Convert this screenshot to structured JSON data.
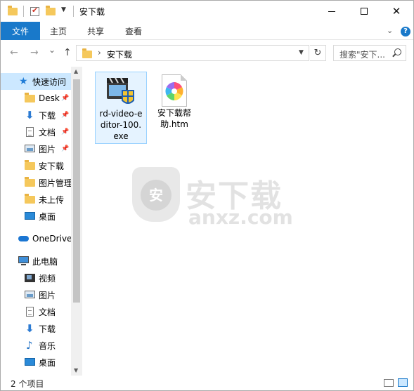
{
  "window": {
    "title": "安下载",
    "controls": {
      "minimize": "minimize",
      "maximize": "maximize",
      "close": "✕"
    }
  },
  "ribbon": {
    "tabs": [
      {
        "label": "文件",
        "active": true
      },
      {
        "label": "主页"
      },
      {
        "label": "共享"
      },
      {
        "label": "查看"
      }
    ],
    "help": "?"
  },
  "nav": {
    "back": "←",
    "forward": "→",
    "recent": "⌄",
    "up": "↑",
    "breadcrumb_separator": "›",
    "address": "安下载",
    "refresh": "↻",
    "search_placeholder": "搜索\"安下..."
  },
  "sidebar": {
    "quick_access": {
      "label": "快速访问",
      "icon": "star-icon"
    },
    "quick_items": [
      {
        "label": "Desk",
        "icon": "folder-icon",
        "pinned": true
      },
      {
        "label": "下载",
        "icon": "download-icon",
        "pinned": true
      },
      {
        "label": "文档",
        "icon": "document-icon",
        "pinned": true
      },
      {
        "label": "图片",
        "icon": "picture-icon",
        "pinned": true
      },
      {
        "label": "安下载",
        "icon": "folder-icon"
      },
      {
        "label": "图片管理",
        "icon": "folder-icon"
      },
      {
        "label": "未上传",
        "icon": "folder-icon"
      },
      {
        "label": "桌面",
        "icon": "desktop-icon"
      }
    ],
    "onedrive": {
      "label": "OneDrive",
      "icon": "cloud-icon"
    },
    "this_pc": {
      "label": "此电脑",
      "icon": "computer-icon"
    },
    "pc_items": [
      {
        "label": "视频",
        "icon": "video-icon"
      },
      {
        "label": "图片",
        "icon": "picture-icon"
      },
      {
        "label": "文档",
        "icon": "document-icon"
      },
      {
        "label": "下载",
        "icon": "download-icon"
      },
      {
        "label": "音乐",
        "icon": "music-icon"
      },
      {
        "label": "桌面",
        "icon": "desktop-icon"
      }
    ]
  },
  "files": [
    {
      "name_lines": [
        "rd-video-e",
        "ditor-100.",
        "exe"
      ],
      "icon": "video-editor-exe-icon",
      "selected": true
    },
    {
      "name_lines": [
        "安下载帮",
        "助.htm"
      ],
      "icon": "htm-file-icon",
      "selected": false
    }
  ],
  "watermark": {
    "cn": "安下载",
    "en": "anxz.com",
    "shield_char": "安"
  },
  "status": {
    "item_count": "2 个项目"
  }
}
